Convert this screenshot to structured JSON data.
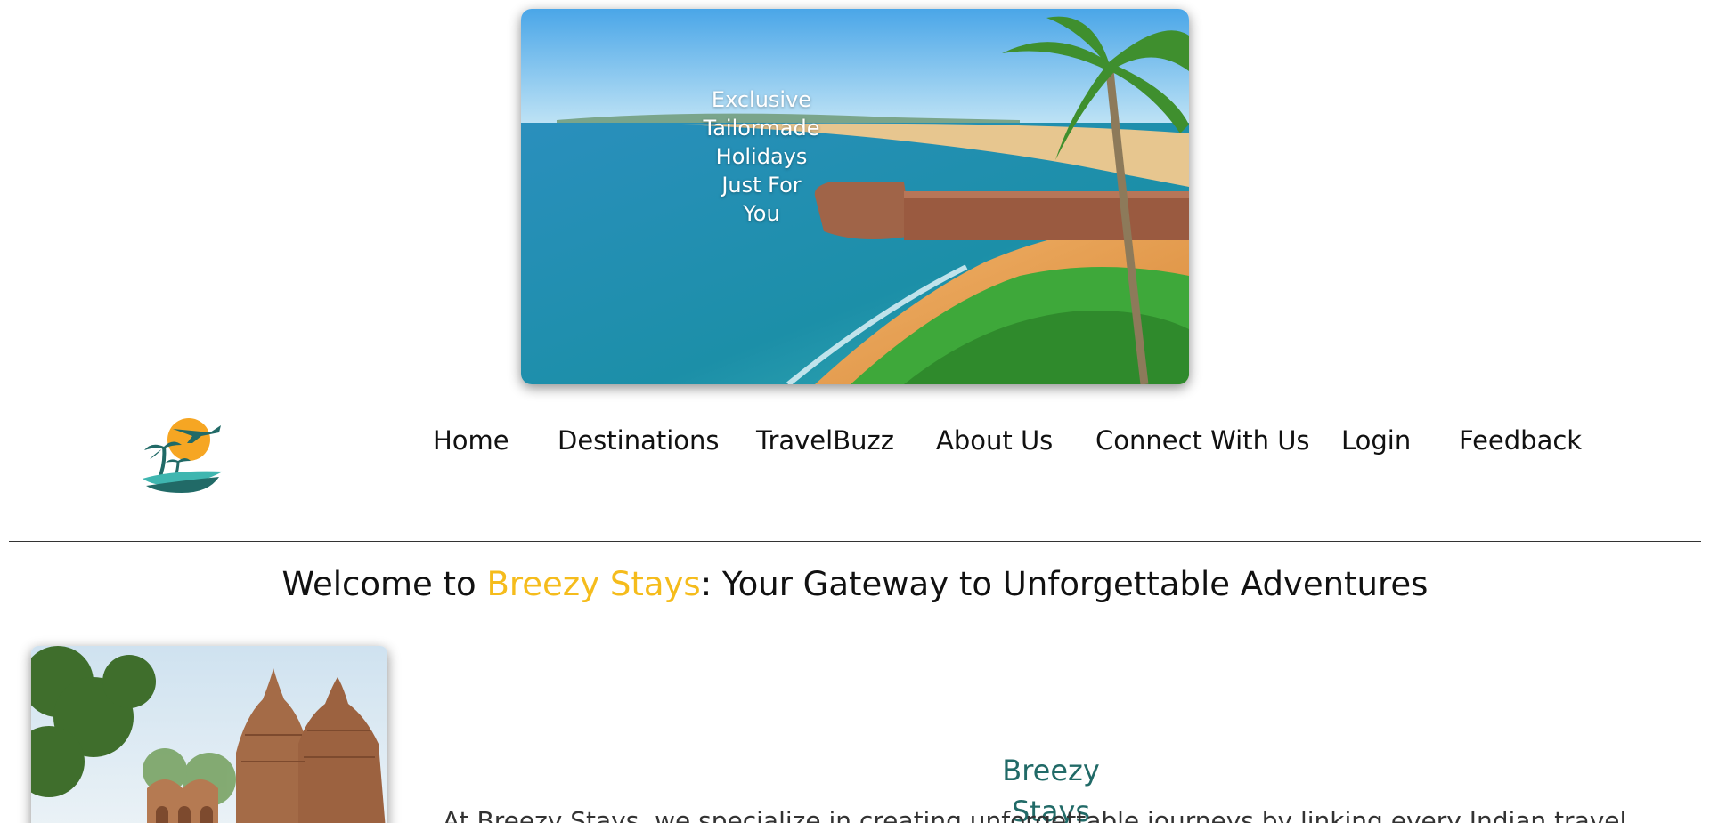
{
  "hero": {
    "caption_lines": [
      "Exclusive",
      "Tailormade",
      "Holidays",
      "Just For",
      "You"
    ],
    "image": "goa-beach-fort-photo"
  },
  "logo": {
    "icon": "breezy-stays-logo-icon"
  },
  "nav": {
    "items": [
      {
        "label": "Home"
      },
      {
        "label": "Destinations"
      },
      {
        "label": "TravelBuzz"
      },
      {
        "label": "About Us"
      },
      {
        "label": "Connect With Us"
      },
      {
        "label": "Login"
      },
      {
        "label": "Feedback"
      }
    ]
  },
  "welcome": {
    "prefix": "Welcome to ",
    "brand": "Breezy Stays",
    "suffix": ": Your Gateway to Unforgettable Adventures"
  },
  "about": {
    "title": "Breezy Stays",
    "text": "At Breezy Stays, we specialize in creating unforgettable journeys by linking every Indian traveler",
    "image": "temple-photo"
  },
  "colors": {
    "brand_yellow": "#f5bc1c",
    "teal": "#216a67",
    "text": "#111111"
  }
}
